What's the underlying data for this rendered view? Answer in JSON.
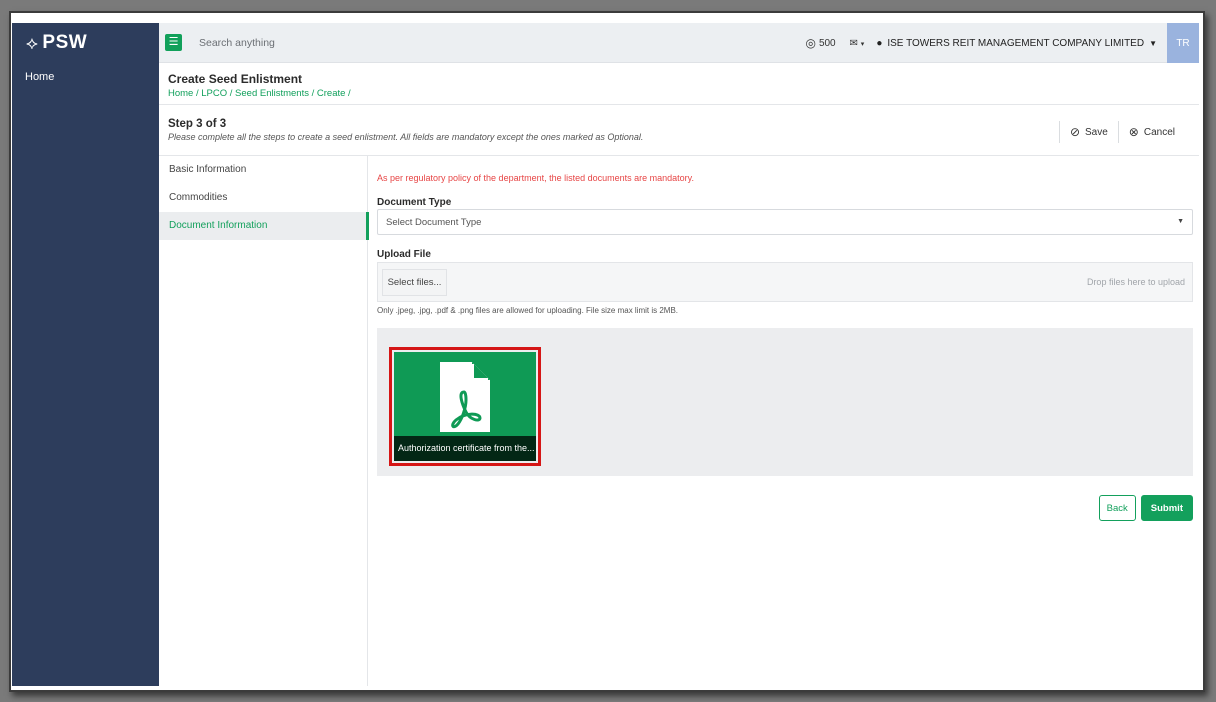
{
  "app": {
    "logo_text": "PSW",
    "logo_mark": "⟡"
  },
  "sidebar": {
    "items": [
      {
        "label": "Home"
      }
    ]
  },
  "topbar": {
    "search_placeholder": "Search anything",
    "credits": "500",
    "company": "ISE TOWERS REIT MANAGEMENT COMPANY LIMITED",
    "avatar_initials": "TR"
  },
  "page": {
    "title": "Create Seed Enlistment",
    "breadcrumb": "Home / LPCO / Seed Enlistments / Create /"
  },
  "step": {
    "title": "Step 3 of 3",
    "description": "Please complete all the steps to create a seed enlistment. All fields are mandatory except the ones marked as Optional.",
    "save_label": "Save",
    "cancel_label": "Cancel"
  },
  "steps_nav": [
    {
      "label": "Basic Information",
      "active": false
    },
    {
      "label": "Commodities",
      "active": false
    },
    {
      "label": "Document Information",
      "active": true
    }
  ],
  "form": {
    "notice": "As per regulatory policy of the department, the listed documents are mandatory.",
    "document_type_label": "Document Type",
    "document_type_value": "Select Document Type",
    "upload_label": "Upload File",
    "select_files_label": "Select files...",
    "drop_text": "Drop files here to upload",
    "hint": "Only .jpeg, .jpg, .pdf & .png files are allowed for uploading. File size max limit is 2MB.",
    "files": [
      {
        "name": "Authorization certificate from the...",
        "type": "pdf"
      }
    ],
    "back_label": "Back",
    "submit_label": "Submit"
  },
  "colors": {
    "sidebar": "#2d3d5c",
    "accent": "#13a05c",
    "notice": "#e74545",
    "highlight": "#d51616"
  }
}
